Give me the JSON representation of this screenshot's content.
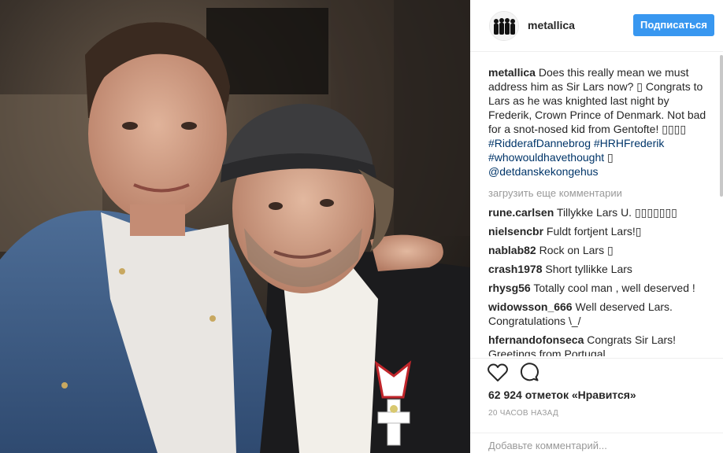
{
  "post": {
    "username": "metallica",
    "follow_label": "Подписаться",
    "avatar_alt": "metallica band avatar",
    "caption": {
      "username": "metallica",
      "text": "Does this really mean we must address him as Sir Lars now? ▯ Congrats to Lars as he was knighted last night by Frederik, Crown Prince of Denmark. Not bad for a snot-nosed kid from Gentofte!",
      "flags": "▯▯▯▯",
      "hashtags": [
        "#RidderafDannebrog",
        "#HRHFrederik",
        "#whowouldhavethought"
      ],
      "after_tags": "▯",
      "mention": "@detdanskekongehus"
    },
    "load_more_label": "загрузить еще комментарии",
    "comments": [
      {
        "user": "rune.carlsen",
        "text": "Tillykke Lars U. ▯▯▯▯▯▯▯"
      },
      {
        "user": "nielsencbr",
        "text": "Fuldt fortjent Lars!▯"
      },
      {
        "user": "nablab82",
        "text": "Rock on Lars ▯"
      },
      {
        "user": "crash1978",
        "text": "Short tyllikke Lars"
      },
      {
        "user": "rhysg56",
        "text": "Totally cool man , well deserved !"
      },
      {
        "user": "widowsson_666",
        "text": "Well deserved Lars. Congratulations \\_/"
      },
      {
        "user": "hfernandofonseca",
        "text": "Congrats Sir Lars! Greetings from Portugal"
      }
    ],
    "likes_label": "62 924 отметок «Нравится»",
    "time_label": "20 ЧАСОВ НАЗАД",
    "add_comment_placeholder": "Добавьте комментарий..."
  },
  "icons": {
    "like": "heart-icon",
    "comment": "comment-icon"
  },
  "colors": {
    "follow_button": "#3897f0",
    "hashtag": "#003569",
    "muted": "#999999"
  }
}
